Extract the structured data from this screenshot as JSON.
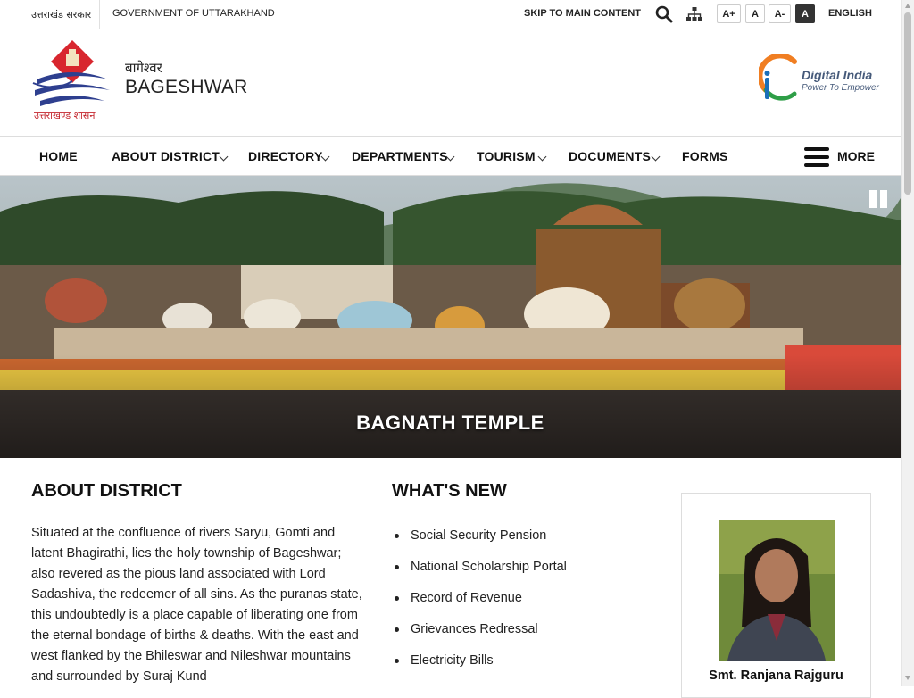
{
  "topbar": {
    "gov_hindi": "उत्तराखंड सरकार",
    "gov_english": "GOVERNMENT OF UTTARAKHAND",
    "skip_link": "SKIP TO MAIN CONTENT",
    "font_increase": "A+",
    "font_normal": "A",
    "font_decrease": "A-",
    "contrast": "A",
    "language": "ENGLISH"
  },
  "header": {
    "state_text_hindi": "उत्तराखण्ड शासन",
    "district_hindi": "बागेश्वर",
    "district_english": "BAGESHWAR",
    "digital_india_title": "Digital India",
    "digital_india_tagline": "Power To Empower"
  },
  "nav": {
    "items": [
      {
        "label": "HOME"
      },
      {
        "label": "ABOUT DISTRICT"
      },
      {
        "label": "DIRECTORY"
      },
      {
        "label": "DEPARTMENTS"
      },
      {
        "label": "TOURISM"
      },
      {
        "label": "DOCUMENTS"
      },
      {
        "label": "FORMS"
      }
    ],
    "more_label": "MORE"
  },
  "banner": {
    "caption": "BAGNATH TEMPLE"
  },
  "about": {
    "title": "ABOUT DISTRICT",
    "text": "Situated at the confluence of rivers Saryu, Gomti and latent Bhagirathi, lies the holy township of Bageshwar; also revered as the pious land associated with Lord Sadashiva, the redeemer of all sins. As the puranas state, this undoubtedly is a place capable of liberating one from the eternal bondage of births & deaths. With the east and west flanked by the Bhileswar and Nileshwar mountains and surrounded by Suraj Kund"
  },
  "whats_new": {
    "title": "WHAT'S NEW",
    "items": [
      "Social Security Pension",
      "National Scholarship Portal",
      "Record of Revenue",
      "Grievances Redressal",
      "Electricity Bills"
    ]
  },
  "person": {
    "name": "Smt. Ranjana Rajguru"
  },
  "colors": {
    "emblem_red": "#d8262e",
    "emblem_blue": "#2e3f8f",
    "digital_india_orange": "#f07e22",
    "digital_india_blue": "#1a6fb8",
    "digital_india_green": "#2e9e47"
  }
}
